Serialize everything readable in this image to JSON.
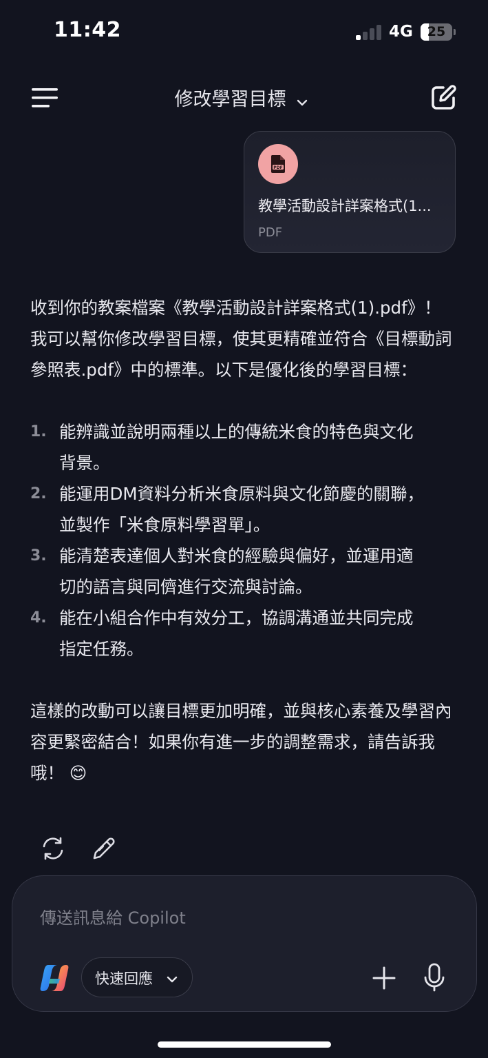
{
  "status_bar": {
    "time": "11:42",
    "network": "4G",
    "battery": "25",
    "battery_level_percent": 25,
    "signal_bars_active": 1,
    "signal_bars_total": 4
  },
  "header": {
    "title": "修改學習目標",
    "menu_icon": "hamburger-menu-icon",
    "title_icon": "chevron-down-icon",
    "compose_icon": "new-chat-edit-icon"
  },
  "attachment": {
    "icon": "pdf-file-icon",
    "name": "教學活動設計詳案格式(1...",
    "type": "PDF"
  },
  "message": {
    "intro": "收到你的教案檔案《教學活動設計詳案格式(1).pdf》！我可以幫你修改學習目標，使其更精確並符合《目標動詞參照表.pdf》中的標準。以下是優化後的學習目標：",
    "objectives": [
      {
        "number": "1.",
        "text": "能辨識並說明兩種以上的傳統米食的特色與文化背景。"
      },
      {
        "number": "2.",
        "text": "能運用DM資料分析米食原料與文化節慶的關聯，並製作「米食原料學習單」。"
      },
      {
        "number": "3.",
        "text": "能清楚表達個人對米食的經驗與偏好，並運用適切的語言與同儕進行交流與討論。"
      },
      {
        "number": "4.",
        "text": "能在小組合作中有效分工，協調溝通並共同完成指定任務。"
      }
    ],
    "closing": "這樣的改動可以讓目標更加明確，並與核心素養及學習內容更緊密結合！如果你有進一步的調整需求，請告訴我哦！ 😊"
  },
  "actions": {
    "regenerate_icon": "regenerate-icon",
    "edit_icon": "edit-pencil-icon"
  },
  "composer": {
    "placeholder": "傳送訊息給 Copilot",
    "value": "",
    "logo_icon": "copilot-logo-icon",
    "mode_label": "快速回應",
    "mode_icon": "chevron-down-icon",
    "plus_icon": "plus-icon",
    "mic_icon": "microphone-icon"
  },
  "colors": {
    "background": "#12141f",
    "card_border": "#3b3d49",
    "pdf_badge": "#f1a3a4",
    "text_primary": "#e9e9ef",
    "text_muted": "#8e8f99"
  }
}
